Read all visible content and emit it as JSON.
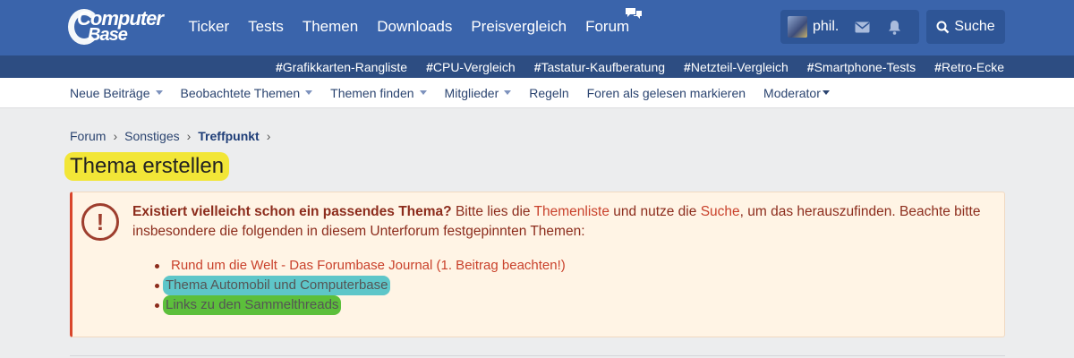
{
  "header": {
    "logo_line1": "Computer",
    "logo_line2": "Base",
    "nav": [
      "Ticker",
      "Tests",
      "Themen",
      "Downloads",
      "Preisvergleich",
      "Forum"
    ],
    "username": "phil.",
    "search_label": "Suche"
  },
  "tags": [
    "Grafikkarten-Rangliste",
    "CPU-Vergleich",
    "Tastatur-Kaufberatung",
    "Netzteil-Vergleich",
    "Smartphone-Tests",
    "Retro-Ecke"
  ],
  "subnav": {
    "neue": "Neue Beiträge",
    "beobachtete": "Beobachtete Themen",
    "finden": "Themen finden",
    "mitglieder": "Mitglieder",
    "regeln": "Regeln",
    "gelesen": "Foren als gelesen markieren",
    "moderator": "Moderator"
  },
  "breadcrumb": [
    "Forum",
    "Sonstiges",
    "Treffpunkt"
  ],
  "page_title": "Thema erstellen",
  "notice": {
    "bold": "Existiert vielleicht schon ein passendes Thema?",
    "t1": " Bitte lies die ",
    "link1": "Themenliste",
    "t2": " und nutze die ",
    "link2": "Suche",
    "t3": ", um das herauszufinden. Beachte bitte insbesondere die folgenden in diesem Unterforum festgepinnten Themen:",
    "items": [
      "Rund um die Welt - Das Forumbase Journal (1. Beitrag beachten!)",
      "Thema Automobil und Computerbase",
      "Links zu den Sammelthreads"
    ]
  },
  "colors": {
    "header": "#3a64ab",
    "tagbar": "#2d4d82",
    "highlight_yellow": "#f2e637",
    "highlight_cyan": "#5ec6c9",
    "highlight_green": "#5cbf3b"
  }
}
